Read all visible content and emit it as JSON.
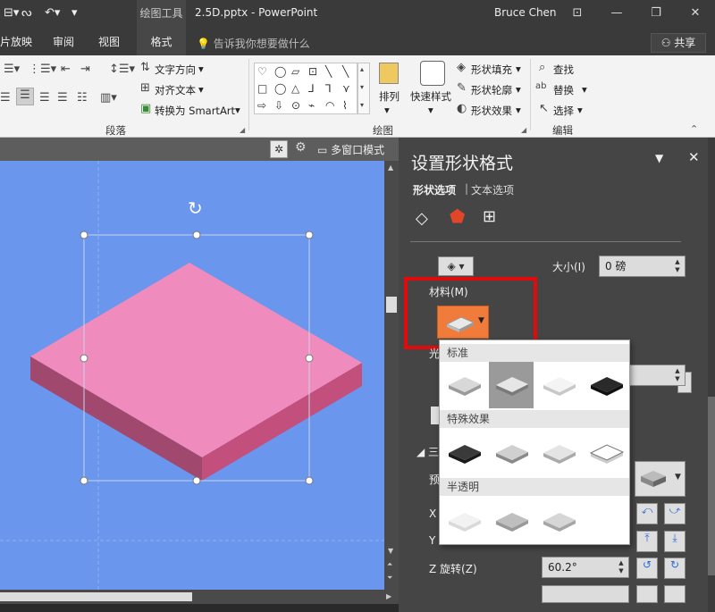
{
  "titlebar": {
    "quick_access": [
      "⊟▾",
      "ᔓ",
      "↶▾",
      "▾"
    ],
    "context_label": "绘图工具",
    "doc_title": "2.5D.pptx - PowerPoint",
    "user": "Bruce Chen",
    "win_buttons": [
      "⊡",
      "—",
      "❐",
      "✕"
    ]
  },
  "tabs": {
    "items": [
      "片放映",
      "审阅",
      "视图"
    ],
    "active": "格式",
    "tell_me": "告诉我你想要做什么",
    "share": "共享"
  },
  "ribbon": {
    "para_group": "段落",
    "text_direction": "文字方向",
    "align_text": "对齐文本",
    "smartart": "转换为 SmartArt",
    "drawing_group": "绘图",
    "arrange": "排列",
    "quick_styles": "快速样式",
    "shape_fill": "形状填充",
    "shape_outline": "形状轮廓",
    "shape_effects": "形状效果",
    "editing_group": "编辑",
    "find": "查找",
    "replace": "替换",
    "select": "选择",
    "shape_glyphs": [
      "♡",
      "◯",
      "▱",
      "⊡",
      "╲",
      "╲",
      "□",
      "◯",
      "△",
      "⅃",
      "⅂",
      "⋎",
      "⇨",
      "⇩",
      "⊙",
      "⌁",
      "◠",
      "⌇"
    ]
  },
  "view_toolbar": {
    "multi_window": "多窗口模式"
  },
  "pane": {
    "title": "设置形状格式",
    "tab_shape": "形状选项",
    "tab_text": "文本选项",
    "size_label": "大小(I)",
    "size_value": "0 磅",
    "material_label": "材料(M)",
    "rotation_z_label": "Z 旋转(Z)",
    "rotation_z_value": "60.2°",
    "partial_labels": [
      "光",
      "三",
      "预",
      "X",
      "Y"
    ]
  },
  "material_dropdown": {
    "section_standard": "标准",
    "section_special": "特殊效果",
    "section_translucent": "半透明",
    "standard_count": 4,
    "selected_index": 1
  },
  "colors": {
    "canvas": "#6a96ed",
    "shape_top": "#f08cbd",
    "shape_left": "#a0486d",
    "shape_right": "#c34f7d",
    "highlight": "#e20a0a",
    "material_btn": "#f07b3a"
  }
}
